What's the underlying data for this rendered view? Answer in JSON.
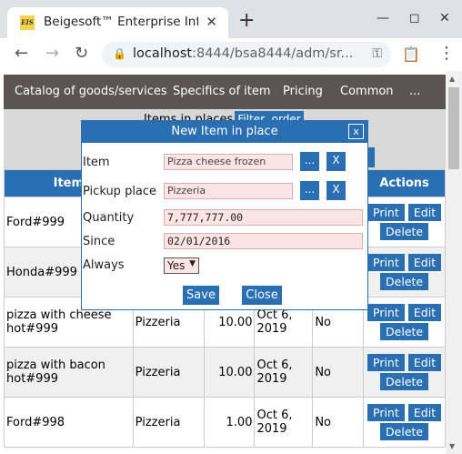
{
  "browser": {
    "tab_title": "Beigesoft™ Enterprise Info",
    "favicon_text": "EIS",
    "url_host": "localhost",
    "url_rest": ":8444/bsa8444/adm/sr..."
  },
  "nav": {
    "items": [
      "Catalog of goods/services",
      "Specifics of item",
      "Pricing",
      "Common",
      "..."
    ]
  },
  "subbar": {
    "label": "Items in places",
    "filter_button": "Filter, order"
  },
  "table": {
    "header_item": "Item",
    "header_actions": "Actions",
    "rows": [
      {
        "item": "Ford#999",
        "place": "",
        "qty": "",
        "since": "",
        "always": ""
      },
      {
        "item": "Honda#999",
        "place": "",
        "qty": "",
        "since": "",
        "always": ""
      },
      {
        "item": "pizza with cheese hot#999",
        "place": "Pizzeria",
        "qty": "10.00",
        "since": "Oct 6, 2019",
        "always": "No"
      },
      {
        "item": "pizza with bacon hot#999",
        "place": "Pizzeria",
        "qty": "10.00",
        "since": "Oct 6, 2019",
        "always": "No"
      },
      {
        "item": "Ford#998",
        "place": "Pizzeria",
        "qty": "1.00",
        "since": "Oct 6, 2019",
        "always": "No"
      }
    ],
    "print_label": "Print",
    "edit_label": "Edit",
    "delete_label": "Delete"
  },
  "dialog": {
    "title": "New Item in place",
    "close_label": "x",
    "item_label": "Item",
    "item_value": "Pizza cheese frozen",
    "pickup_label": "Pickup place",
    "pickup_value": "Pizzeria",
    "quantity_label": "Quantity",
    "quantity_value": "7,777,777.00",
    "since_label": "Since",
    "since_value": "02/01/2016",
    "always_label": "Always",
    "always_value": "Yes",
    "ellipsis_label": "...",
    "clear_label": "X",
    "save_label": "Save",
    "cancel_label": "Close"
  }
}
